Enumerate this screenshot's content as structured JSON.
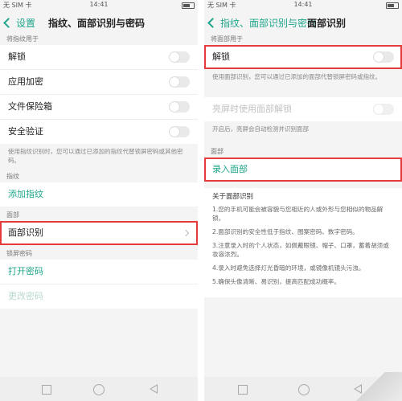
{
  "colors": {
    "accent": "#1ea58a",
    "highlight": "#e53b3b"
  },
  "left": {
    "status": {
      "carrier": "无 SIM 卡",
      "time": "14:41"
    },
    "nav": {
      "back": "设置",
      "title": "指纹、面部识别与密码"
    },
    "fingerprint_section": "将指纹用于",
    "fingerprint_rows": [
      {
        "label": "解锁"
      },
      {
        "label": "应用加密"
      },
      {
        "label": "文件保险箱"
      },
      {
        "label": "安全验证"
      }
    ],
    "fingerprint_note": "使用指纹识别时，您可以通过已添加的指纹代替锁屏密码或其他密码。",
    "fp_section": "指纹",
    "add_fp": "添加指纹",
    "face_section": "面部",
    "face_row": "面部识别",
    "lock_section": "锁屏密码",
    "open_pwd": "打开密码",
    "change_pwd": "更改密码"
  },
  "right": {
    "status": {
      "carrier": "无 SIM 卡",
      "time": "14:41"
    },
    "nav": {
      "back": "指纹、面部识别与密码",
      "title": "面部识别"
    },
    "use_section": "将面部用于",
    "unlock": "解锁",
    "unlock_note": "使用面部识别，您可以通过已添加的面部代替锁屏密码或指纹。",
    "screen_on": "亮屏时使用面部解锁",
    "screen_on_note": "开启后，亮屏会自动检测并识别面部",
    "face_section": "面部",
    "enroll": "录入面部",
    "about_title": "关于面部识别",
    "about_items": [
      "1.您的手机可能会被容貌与您相近的人或外形与您相似的物品解锁。",
      "2.面部识别的安全性低于指纹、图案密码、数字密码。",
      "3.注意录入时的个人状态，如佩戴眼镜、帽子、口罩，蓄着胡须或妆容浓烈。",
      "4.录入时避免选择灯光昏暗的环境，或镜像机镜头污浊。",
      "5.确保头像清晰、易识别，提高匹配成功概率。"
    ]
  }
}
